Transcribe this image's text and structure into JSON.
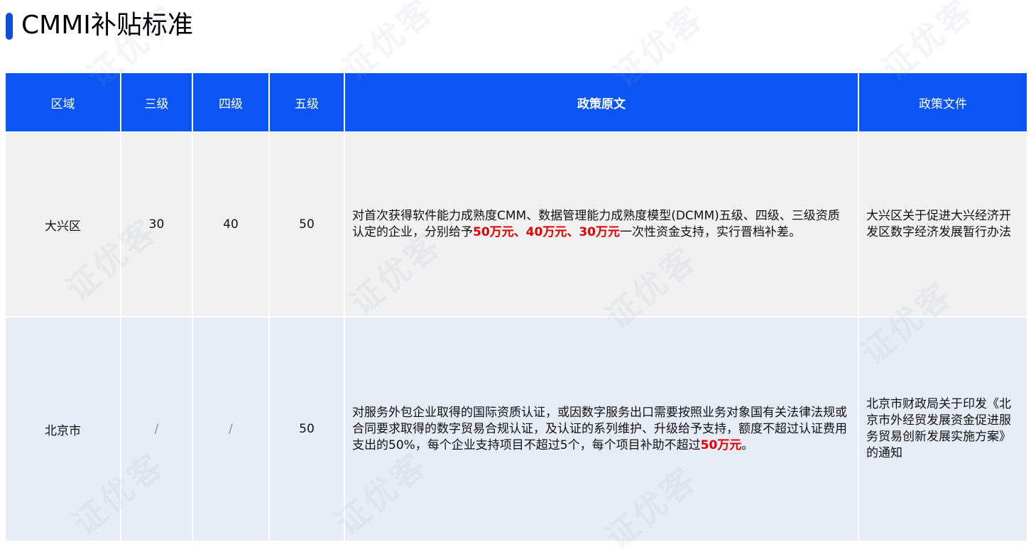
{
  "title": "CMMI补贴标准",
  "watermark": "证优客",
  "colors": {
    "header_bg": "#0b55f5",
    "accent_bar": "#0f4fd8",
    "highlight": "#e30000",
    "row1_bg": "#f1f1f1",
    "row2_bg": "#e7edf7"
  },
  "table": {
    "headers": [
      "区域",
      "三级",
      "四级",
      "五级",
      "政策原文",
      "政策文件"
    ],
    "rows": [
      {
        "region": "大兴区",
        "level3": "30",
        "level4": "40",
        "level5": "50",
        "policy_pre": "对首次获得软件能力成熟度CMM、数据管理能力成熟度模型(DCMM)五级、四级、三级资质认定的企业，分别给予",
        "policy_highlight": "50万元、40万元、30万元",
        "policy_post": "一次性资金支持，实行晋档补差。",
        "file": "大兴区关于促进大兴经济开发区数字经济发展暂行办法"
      },
      {
        "region": "北京市",
        "level3": "/",
        "level4": "/",
        "level5": "50",
        "policy_pre": "对服务外包企业取得的国际资质认证，或因数字服务出口需要按照业务对象国有关法律法规或合同要求取得的数字贸易合规认证，及认证的系列维护、升级给予支持，额度不超过认证费用支出的50%，每个企业支持项目不超过5个，每个项目补助不超过",
        "policy_highlight": "50万元",
        "policy_post": "。",
        "file": "北京市财政局关于印发《北京市外经贸发展资金促进服务贸易创新发展实施方案》的通知"
      }
    ]
  }
}
